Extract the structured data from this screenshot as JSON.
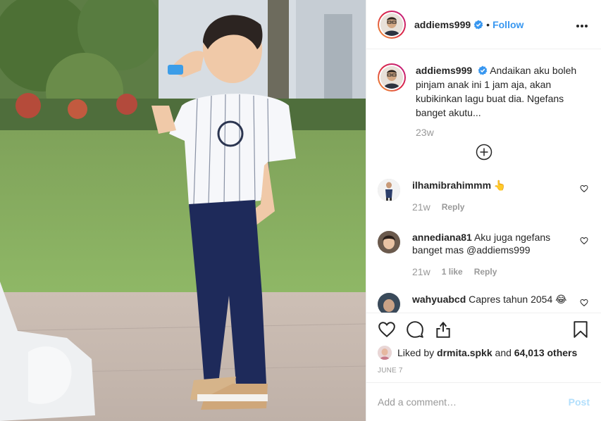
{
  "post": {
    "author": "addiems999",
    "follow_label": "Follow",
    "separator": "•",
    "caption": {
      "username": "addiems999",
      "text": "Andaikan aku boleh pinjam anak ini 1 jam aja, akan kubikinkan lagu buat dia. Ngefans banget akutu...",
      "time": "23w"
    },
    "comments": [
      {
        "username": "ilhamibrahimmm",
        "text": "👆",
        "time": "21w",
        "likes": "",
        "reply": "Reply"
      },
      {
        "username": "annediana81",
        "text": "Aku juga ngefans banget mas @addiems999",
        "time": "21w",
        "likes": "1 like",
        "reply": "Reply"
      },
      {
        "username": "wahyuabcd",
        "text": "Capres tahun 2054 😂",
        "time": "",
        "likes": "",
        "reply": ""
      }
    ],
    "liked_by": {
      "prefix": "Liked by",
      "user": "drmita.spkk",
      "and": "and",
      "count": "64,013 others"
    },
    "date": "JUNE 7",
    "add_comment_placeholder": "Add a comment…",
    "post_label": "Post"
  },
  "colors": {
    "link": "#3897f0",
    "muted": "#999999",
    "post_disabled": "#b2dffc"
  },
  "icons": [
    "verified-badge-icon",
    "more-options-icon",
    "load-more-plus-icon",
    "heart-icon",
    "comment-icon",
    "share-icon",
    "bookmark-icon"
  ]
}
